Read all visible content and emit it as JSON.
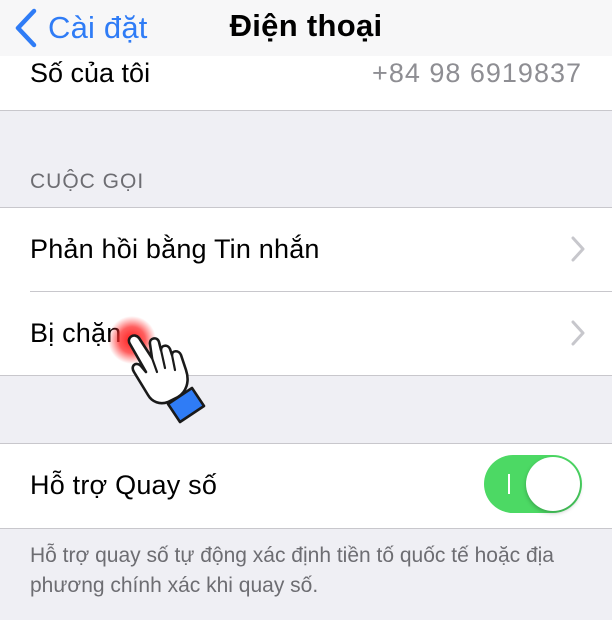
{
  "nav": {
    "back_label": "Cài đặt",
    "title": "Điện thoại"
  },
  "my_number": {
    "label": "Số của tôi",
    "value": "+84 98 6919837"
  },
  "calls_section": {
    "header": "CUỘC GỌI",
    "items": [
      {
        "label": "Phản hồi bằng Tin nhắn"
      },
      {
        "label": "Bị chặn"
      }
    ]
  },
  "dial_assist": {
    "label": "Hỗ trợ Quay số",
    "enabled": true,
    "footer": "Hỗ trợ quay số tự động xác định tiền tố quốc tế hoặc địa phương chính xác khi quay số."
  },
  "colors": {
    "accent": "#2f7cf6",
    "toggle_on": "#4cd964",
    "background": "#efeff4",
    "tap_highlight": "#ff2020",
    "pointer_cuff": "#2f7cf6"
  },
  "icons": {
    "back": "chevron-left-icon",
    "disclosure": "chevron-right-icon",
    "pointer": "hand-pointer-icon"
  }
}
